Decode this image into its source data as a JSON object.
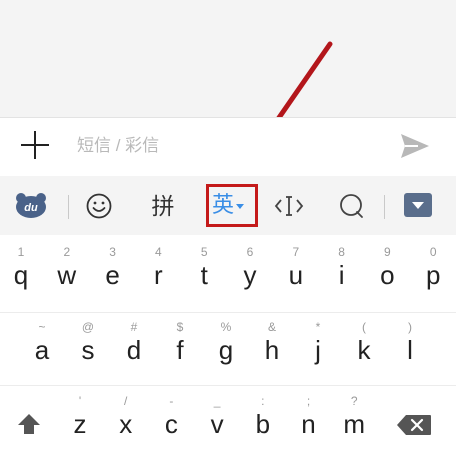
{
  "composer": {
    "placeholder": "短信 / 彩信"
  },
  "toolbar": {
    "pinyin_label": "拼",
    "english_label": "英"
  },
  "keyboard": {
    "row1": [
      {
        "hint": "1",
        "letter": "q"
      },
      {
        "hint": "2",
        "letter": "w"
      },
      {
        "hint": "3",
        "letter": "e"
      },
      {
        "hint": "4",
        "letter": "r"
      },
      {
        "hint": "5",
        "letter": "t"
      },
      {
        "hint": "6",
        "letter": "y"
      },
      {
        "hint": "7",
        "letter": "u"
      },
      {
        "hint": "8",
        "letter": "i"
      },
      {
        "hint": "9",
        "letter": "o"
      },
      {
        "hint": "0",
        "letter": "p"
      }
    ],
    "row2": [
      {
        "hint": "~",
        "letter": "a"
      },
      {
        "hint": "@",
        "letter": "s"
      },
      {
        "hint": "#",
        "letter": "d"
      },
      {
        "hint": "$",
        "letter": "f"
      },
      {
        "hint": "%",
        "letter": "g"
      },
      {
        "hint": "&",
        "letter": "h"
      },
      {
        "hint": "*",
        "letter": "j"
      },
      {
        "hint": "(",
        "letter": "k"
      },
      {
        "hint": ")",
        "letter": "l"
      }
    ],
    "row3": [
      {
        "hint": "'",
        "letter": "z"
      },
      {
        "hint": "/",
        "letter": "x"
      },
      {
        "hint": "-",
        "letter": "c"
      },
      {
        "hint": "_",
        "letter": "v"
      },
      {
        "hint": ":",
        "letter": "b"
      },
      {
        "hint": ";",
        "letter": "n"
      },
      {
        "hint": "?",
        "letter": "m"
      }
    ]
  },
  "colors": {
    "highlight_box": "#c41a1a",
    "annotation_arrow": "#b3161b",
    "active_ime_text": "#3a8ee6"
  }
}
